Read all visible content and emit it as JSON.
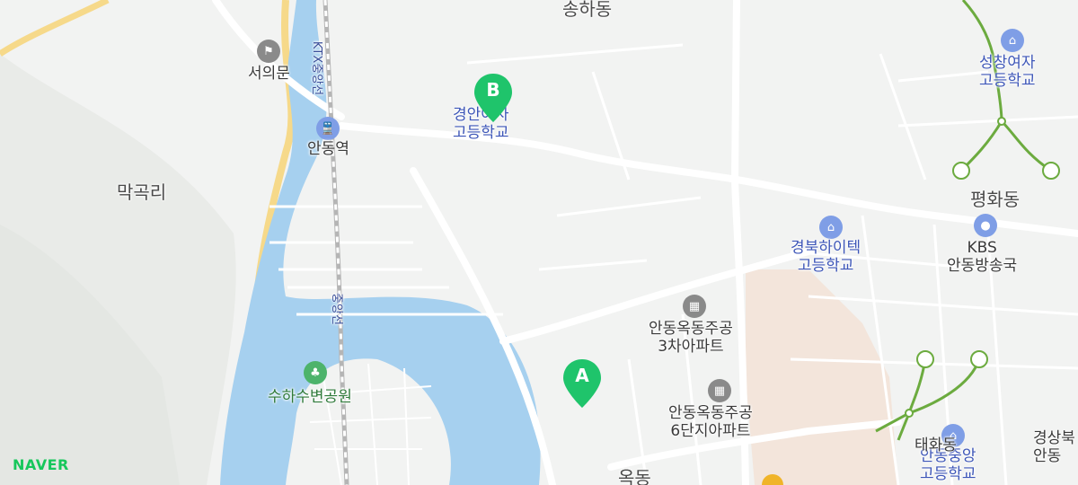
{
  "map": {
    "districts": [
      {
        "name": "송하동"
      },
      {
        "name": "막곡리"
      },
      {
        "name": "평화동"
      },
      {
        "name": "옥동"
      }
    ],
    "pois": [
      {
        "name": "서의문",
        "type": "landmark"
      },
      {
        "name": "안동역",
        "type": "station"
      },
      {
        "name": "경안여자\n고등학교",
        "type": "school"
      },
      {
        "name": "성창여자\n고등학교",
        "type": "school"
      },
      {
        "name": "경북하이텍\n고등학교",
        "type": "school"
      },
      {
        "name": "KBS\n안동방송국",
        "type": "broadcast"
      },
      {
        "name": "안동옥동주공\n3차아파트",
        "type": "apartment"
      },
      {
        "name": "안동옥동주공\n6단지아파트",
        "type": "apartment"
      },
      {
        "name": "수하수변공원",
        "type": "park"
      },
      {
        "name": "안동중앙\n고등학교",
        "type": "school"
      },
      {
        "name": "경상북\n안동",
        "type": "partial"
      },
      {
        "name": "태화동",
        "type": "partial"
      }
    ],
    "rail_labels": [
      "KTX중앙선",
      "중앙선"
    ],
    "markers": [
      {
        "letter": "A",
        "color": "#1fc46b"
      },
      {
        "letter": "B",
        "color": "#1fc46b"
      }
    ],
    "logo": "NAVER",
    "colors": {
      "water": "#a6d0ef",
      "land": "#f2f3f2",
      "road": "#ffffff",
      "highway": "#f6d98a",
      "commercial": "#f3dccb",
      "trail": "#6cab3f"
    }
  }
}
